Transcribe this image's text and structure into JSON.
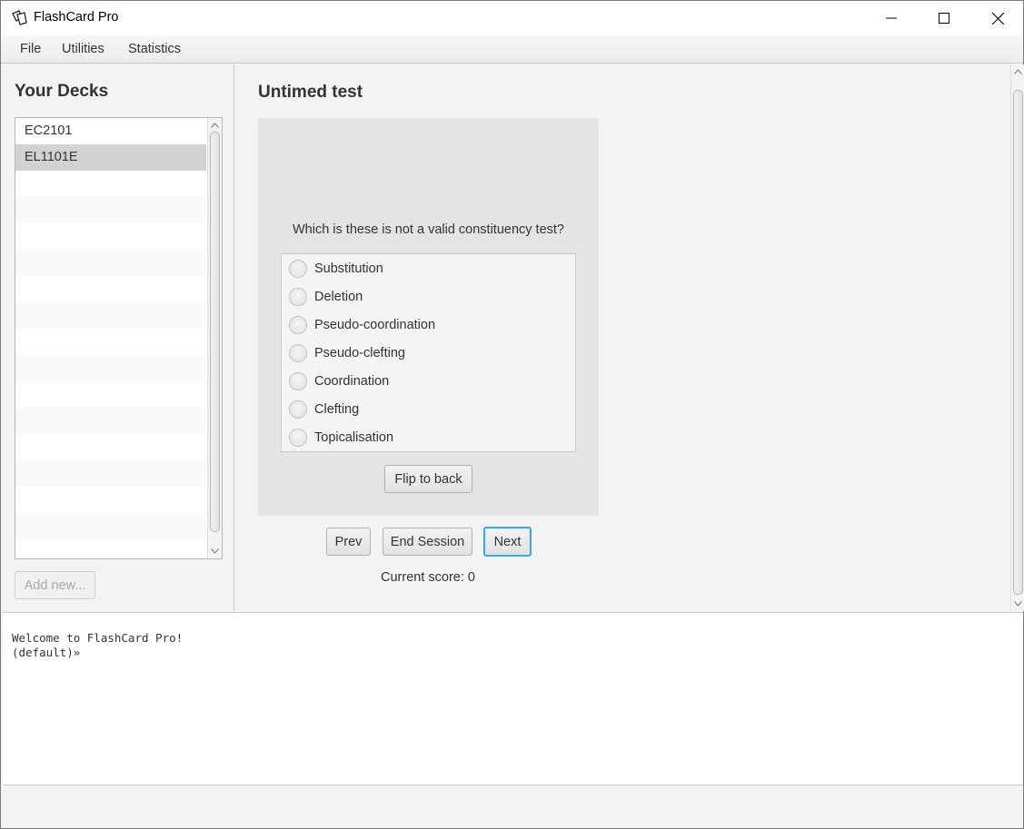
{
  "window": {
    "title": "FlashCard Pro",
    "controls": [
      "minimize",
      "maximize",
      "close"
    ]
  },
  "menubar": {
    "items": [
      "File",
      "Utilities",
      "Statistics"
    ]
  },
  "sidebar": {
    "title": "Your Decks",
    "decks": [
      {
        "name": "EC2101",
        "selected": false
      },
      {
        "name": "EL1101E",
        "selected": true
      }
    ],
    "add_button": "Add new..."
  },
  "test": {
    "title": "Untimed test",
    "question": "Which is these is not a valid constituency test?",
    "options": [
      "Substitution",
      "Deletion",
      "Pseudo-coordination",
      "Pseudo-clefting",
      "Coordination",
      "Clefting",
      "Topicalisation"
    ],
    "flip_button": "Flip to back",
    "prev_button": "Prev",
    "end_button": "End Session",
    "next_button": "Next",
    "score_text": "Current score: 0"
  },
  "console": {
    "lines": [
      "Welcome to FlashCard Pro!",
      "(default)»"
    ]
  },
  "colors": {
    "focus_accent": "#45a5e0",
    "selected_row": "#d2d2d2",
    "card_bg": "#e4e4e4"
  }
}
